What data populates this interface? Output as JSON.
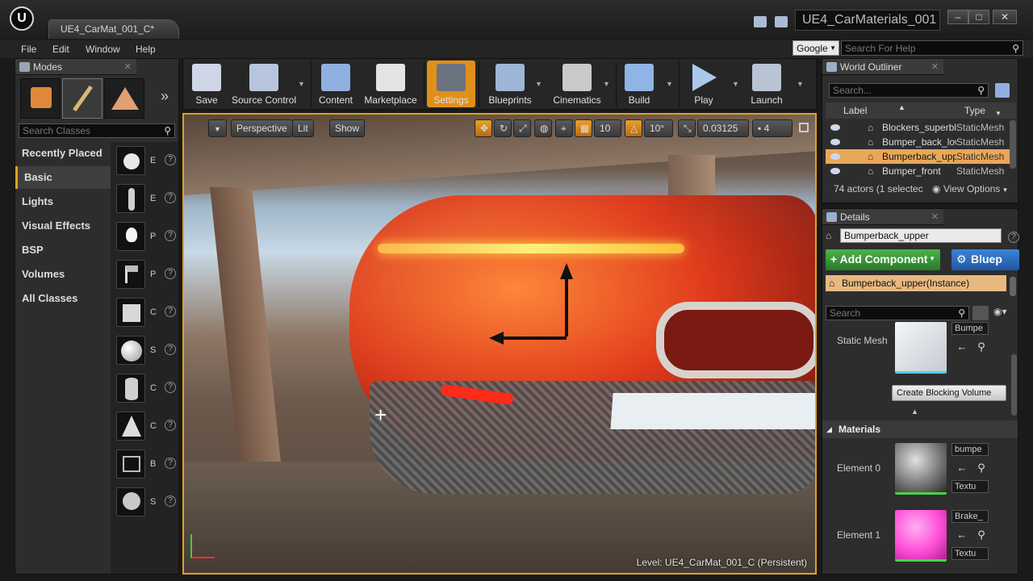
{
  "window": {
    "document_tab": "UE4_CarMat_001_C*",
    "project_name": "UE4_CarMaterials_001",
    "logo_text": "U",
    "controls": {
      "minimize": "–",
      "maximize": "□",
      "close": "✕"
    }
  },
  "menu": [
    "File",
    "Edit",
    "Window",
    "Help"
  ],
  "help_search": {
    "engine": "Google",
    "placeholder": "Search For Help"
  },
  "modes": {
    "tab_title": "Modes",
    "search_placeholder": "Search Classes",
    "categories": [
      "Recently Placed",
      "Basic",
      "Lights",
      "Visual Effects",
      "BSP",
      "Volumes",
      "All Classes"
    ],
    "active_category": "Basic",
    "classes": [
      {
        "initial": "E",
        "icon": "empty-actor-icon"
      },
      {
        "initial": "E",
        "icon": "empty-character-icon"
      },
      {
        "initial": "P",
        "icon": "point-light-icon"
      },
      {
        "initial": "P",
        "icon": "player-start-icon"
      },
      {
        "initial": "C",
        "icon": "cube-icon"
      },
      {
        "initial": "S",
        "icon": "sphere-icon"
      },
      {
        "initial": "C",
        "icon": "cylinder-icon"
      },
      {
        "initial": "C",
        "icon": "cone-icon"
      },
      {
        "initial": "B",
        "icon": "box-trigger-icon"
      },
      {
        "initial": "S",
        "icon": "sphere-trigger-icon"
      }
    ],
    "help_glyph": "?"
  },
  "toolbar": [
    {
      "label": "Save",
      "icon": "save-icon",
      "color": "#cfd6e8"
    },
    {
      "label": "Source Control",
      "icon": "source-control-icon",
      "color": "#b7c6dc"
    },
    {
      "label": "Content",
      "icon": "content-icon",
      "color": "#8fb0e0"
    },
    {
      "label": "Marketplace",
      "icon": "marketplace-icon",
      "color": "#e4e4e4"
    },
    {
      "label": "Settings",
      "icon": "settings-icon",
      "color": "#b0b8c4"
    },
    {
      "label": "Blueprints",
      "icon": "blueprints-icon",
      "color": "#9db6d6"
    },
    {
      "label": "Cinematics",
      "icon": "cinematics-icon",
      "color": "#c9c9c9"
    },
    {
      "label": "Build",
      "icon": "build-icon",
      "color": "#8fb4e6"
    },
    {
      "label": "Play",
      "icon": "play-icon",
      "color": "#a9c8ec"
    },
    {
      "label": "Launch",
      "icon": "launch-icon",
      "color": "#b8c4d4"
    }
  ],
  "viewport": {
    "perspective": "Perspective",
    "lit": "Lit",
    "show": "Show",
    "grid_snap": "10",
    "rotation_snap": "10°",
    "scale_snap": "0.03125",
    "camera_speed": "4",
    "level_label": "Level:  UE4_CarMat_001_C (Persistent)"
  },
  "world_outliner": {
    "tab_title": "World Outliner",
    "search_placeholder": "Search...",
    "columns": {
      "label": "Label",
      "type": "Type"
    },
    "rows": [
      {
        "label": "Blockers_superbl",
        "type": "StaticMesh",
        "selected": false
      },
      {
        "label": "Bumper_back_low",
        "type": "StaticMesh",
        "selected": false
      },
      {
        "label": "Bumperback_upp",
        "type": "StaticMesh",
        "selected": true
      },
      {
        "label": "Bumper_front",
        "type": "StaticMesh",
        "selected": false
      }
    ],
    "status": "74 actors (1 selectec",
    "view_options": "View Options"
  },
  "details": {
    "tab_title": "Details",
    "actor_name": "Bumperback_upper",
    "add_component": "+ Add Component",
    "blueprint": "Bluep",
    "instance": "Bumperback_upper(Instance)",
    "search_placeholder": "Search",
    "static_mesh_label": "Static Mesh",
    "static_mesh_value": "Bumpe",
    "blocking_volume": "Create Blocking Volume",
    "materials_header": "Materials",
    "elements": [
      {
        "label": "Element 0",
        "material": "bumpe",
        "texture": "Textu",
        "color": "#8a8a8a"
      },
      {
        "label": "Element 1",
        "material": "Brake_",
        "texture": "Textu",
        "color": "#ff4fd8"
      }
    ]
  }
}
